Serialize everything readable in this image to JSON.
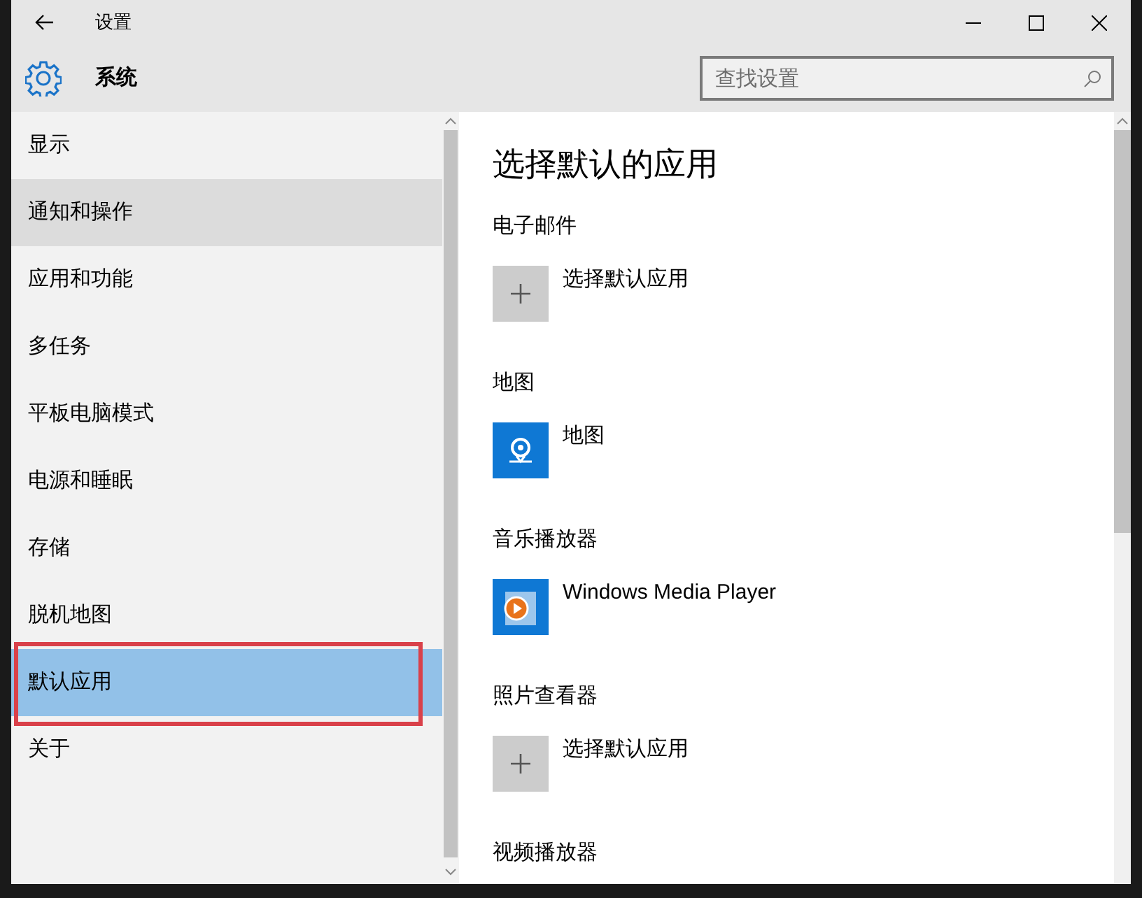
{
  "window": {
    "title": "设置"
  },
  "header": {
    "title": "系统"
  },
  "search": {
    "placeholder": "查找设置"
  },
  "sidebar": {
    "items": [
      {
        "label": "显示",
        "selected": false,
        "hovered": false,
        "callout": false
      },
      {
        "label": "通知和操作",
        "selected": false,
        "hovered": true,
        "callout": false
      },
      {
        "label": "应用和功能",
        "selected": false,
        "hovered": false,
        "callout": false
      },
      {
        "label": "多任务",
        "selected": false,
        "hovered": false,
        "callout": false
      },
      {
        "label": "平板电脑模式",
        "selected": false,
        "hovered": false,
        "callout": false
      },
      {
        "label": "电源和睡眠",
        "selected": false,
        "hovered": false,
        "callout": false
      },
      {
        "label": "存储",
        "selected": false,
        "hovered": false,
        "callout": false
      },
      {
        "label": "脱机地图",
        "selected": false,
        "hovered": false,
        "callout": false
      },
      {
        "label": "默认应用",
        "selected": true,
        "hovered": false,
        "callout": true
      },
      {
        "label": "关于",
        "selected": false,
        "hovered": false,
        "callout": false
      }
    ]
  },
  "content": {
    "heading": "选择默认的应用",
    "sections": [
      {
        "label": "电子邮件",
        "app": {
          "kind": "add",
          "name": "选择默认应用"
        }
      },
      {
        "label": "地图",
        "app": {
          "kind": "maps",
          "name": "地图"
        }
      },
      {
        "label": "音乐播放器",
        "app": {
          "kind": "media",
          "name": "Windows Media Player"
        }
      },
      {
        "label": "照片查看器",
        "app": {
          "kind": "add",
          "name": "选择默认应用"
        }
      },
      {
        "label": "视频播放器"
      }
    ]
  }
}
